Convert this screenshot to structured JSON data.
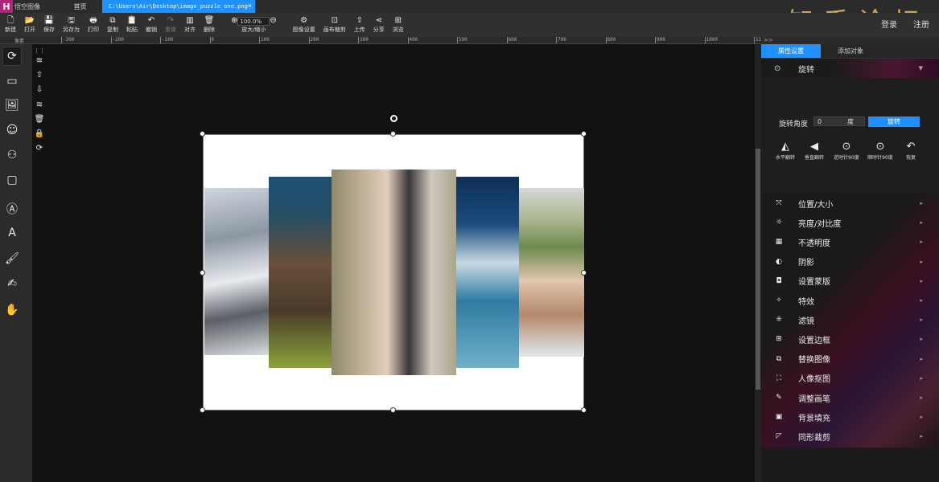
{
  "titlebar": {
    "logo": "H",
    "app_name": "悟空图像",
    "tab_home": "首页",
    "tab_file": "C:\\Users\\Air\\Desktop\\image_puzzle_one.png",
    "close": "×",
    "watermark": "知乎论坛"
  },
  "toolbar": {
    "items": [
      {
        "icon": "new-icon",
        "glyph": "🗋",
        "label": "新建"
      },
      {
        "icon": "open-icon",
        "glyph": "📂",
        "label": "打开"
      },
      {
        "icon": "save-icon",
        "glyph": "💾",
        "label": "保存"
      },
      {
        "icon": "save-as-icon",
        "glyph": "🖫",
        "label": "另存为"
      },
      {
        "icon": "print-icon",
        "glyph": "🖶",
        "label": "打印"
      },
      {
        "icon": "copy-icon",
        "glyph": "⧉",
        "label": "复制"
      },
      {
        "icon": "paste-icon",
        "glyph": "📋",
        "label": "粘贴"
      },
      {
        "icon": "undo-icon",
        "glyph": "↶",
        "label": "撤销"
      },
      {
        "icon": "redo-icon",
        "glyph": "↷",
        "label": "重做"
      },
      {
        "icon": "align-icon",
        "glyph": "▥",
        "label": "对齐"
      },
      {
        "icon": "delete-icon",
        "glyph": "🗑",
        "label": "删除"
      }
    ],
    "zoom_value": "100.0%",
    "zoom_label": "放大/缩小",
    "right_items": [
      {
        "icon": "image-settings-icon",
        "glyph": "⚙",
        "label": "图像设置"
      },
      {
        "icon": "canvas-crop-icon",
        "glyph": "⊡",
        "label": "画布裁剪"
      },
      {
        "icon": "upload-icon",
        "glyph": "⇪",
        "label": "上传"
      },
      {
        "icon": "share-icon",
        "glyph": "⋖",
        "label": "分享"
      },
      {
        "icon": "browse-icon",
        "glyph": "⊞",
        "label": "浏览"
      }
    ],
    "login": "登录",
    "register": "注册"
  },
  "ruler": {
    "label": "像素",
    "ticks": [
      "-300",
      "-200",
      "-100",
      "0",
      "100",
      "200",
      "300",
      "400",
      "500",
      "600",
      "700",
      "800",
      "900",
      "1000",
      "1100"
    ]
  },
  "right_panel": {
    "collapse": ">>",
    "tabs": [
      "属性设置",
      "添加对象"
    ],
    "rotate": {
      "title": "旋转",
      "angle_label": "旋转角度",
      "angle_value": "0",
      "unit": "度",
      "button": "旋转",
      "actions": [
        {
          "icon": "flip-horizontal-icon",
          "glyph": "◭",
          "label": "水平翻转"
        },
        {
          "icon": "flip-vertical-icon",
          "glyph": "◀",
          "label": "垂直翻转"
        },
        {
          "icon": "rotate-ccw-icon",
          "glyph": "⊙",
          "label": "逆时针90度"
        },
        {
          "icon": "rotate-cw-icon",
          "glyph": "⊙",
          "label": "顺时针90度"
        },
        {
          "icon": "reset-icon",
          "glyph": "↶",
          "label": "恢复"
        }
      ]
    },
    "properties": [
      {
        "icon": "position-size-icon",
        "glyph": "⤧",
        "label": "位置/大小"
      },
      {
        "icon": "brightness-icon",
        "glyph": "☼",
        "label": "亮度/对比度"
      },
      {
        "icon": "opacity-icon",
        "glyph": "▦",
        "label": "不透明度"
      },
      {
        "icon": "shadow-icon",
        "glyph": "◐",
        "label": "阴影"
      },
      {
        "icon": "mask-icon",
        "glyph": "◘",
        "label": "设置蒙版"
      },
      {
        "icon": "effects-icon",
        "glyph": "✧",
        "label": "特效"
      },
      {
        "icon": "filter-icon",
        "glyph": "⁜",
        "label": "滤镜"
      },
      {
        "icon": "border-icon",
        "glyph": "⊞",
        "label": "设置边框"
      },
      {
        "icon": "replace-image-icon",
        "glyph": "⧉",
        "label": "替换图像"
      },
      {
        "icon": "portrait-cutout-icon",
        "glyph": "⛶",
        "label": "人像抠图"
      },
      {
        "icon": "adjust-brush-icon",
        "glyph": "✎",
        "label": "调整画笔"
      },
      {
        "icon": "background-fill-icon",
        "glyph": "▣",
        "label": "背景填充"
      },
      {
        "icon": "shape-crop-icon",
        "glyph": "◸",
        "label": "同形裁剪"
      }
    ]
  }
}
